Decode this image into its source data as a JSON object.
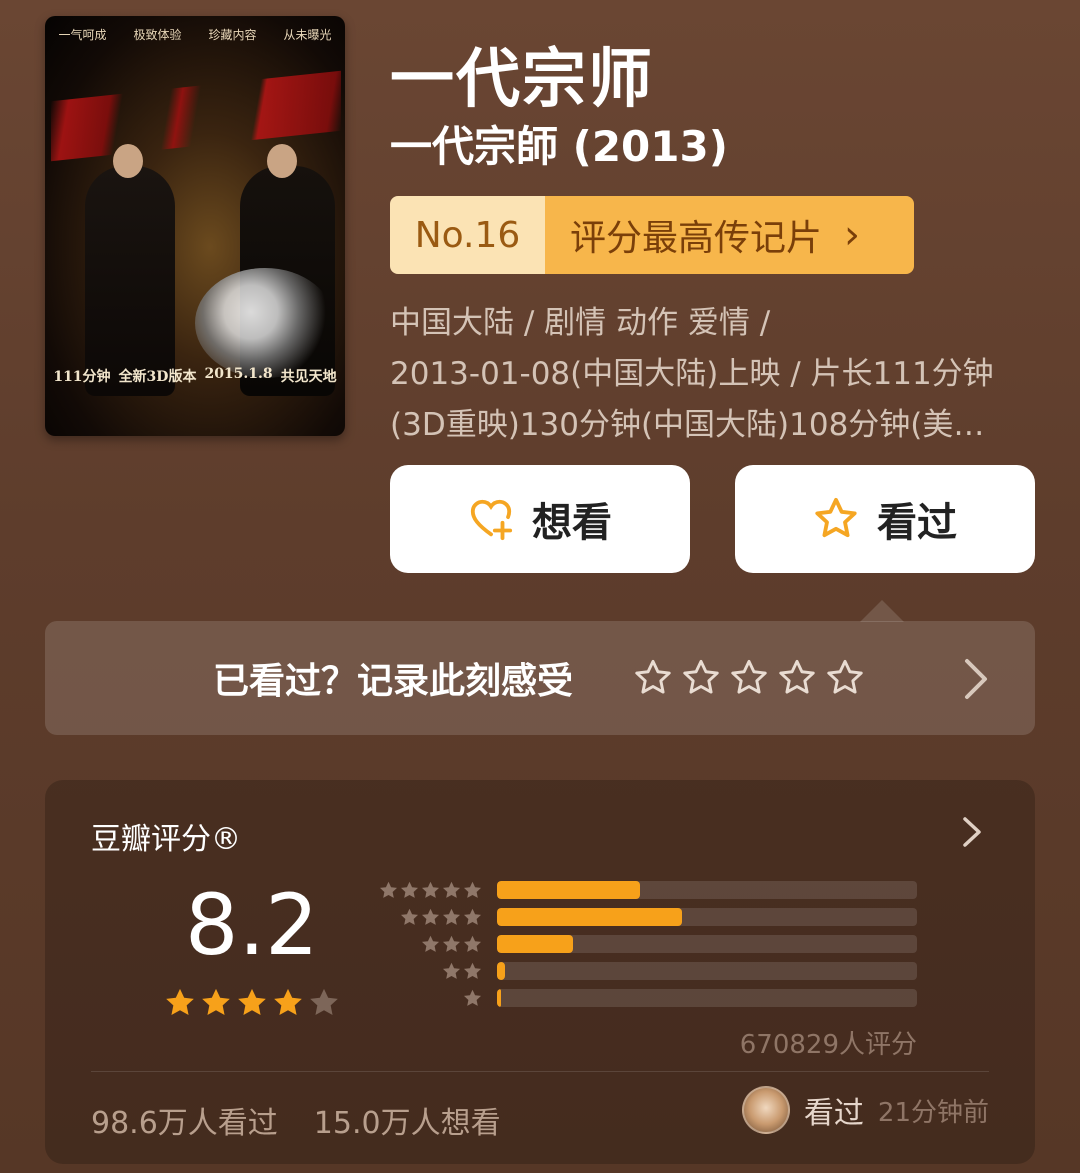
{
  "poster": {
    "top_strip": [
      "一气呵成",
      "极致体验",
      "珍藏内容",
      "从未曝光"
    ],
    "bottom_strip": [
      "111分钟",
      "全新3D版本",
      "2015.1.8",
      "共见天地"
    ]
  },
  "movie": {
    "title": "一代宗师",
    "original_title": "一代宗師 (2013)"
  },
  "rank": {
    "number": "No.16",
    "label": "评分最高传记片",
    "chevron": "›"
  },
  "info_lines": [
    "中国大陆 / 剧情 动作 爱情 /",
    "2013-01-08(中国大陆)上映 / 片长111分钟",
    "(3D重映)130分钟(中国大陆)108分钟(美…"
  ],
  "buttons": {
    "want": {
      "label": "想看",
      "icon": "heart-plus-icon"
    },
    "seen": {
      "label": "看过",
      "icon": "star-outline-icon"
    }
  },
  "record": {
    "prompt": "已看过？记录此刻感受",
    "stars": 5
  },
  "rating": {
    "header": "豆瓣评分®",
    "score": "8.2",
    "stars_filled": 4,
    "distribution": [
      {
        "stars": 5,
        "fraction": 0.34
      },
      {
        "stars": 4,
        "fraction": 0.44
      },
      {
        "stars": 3,
        "fraction": 0.18
      },
      {
        "stars": 2,
        "fraction": 0.02
      },
      {
        "stars": 1,
        "fraction": 0.01
      }
    ],
    "count_label": "670829人评分",
    "watched": "98.6万人看过",
    "wanted": "15.0万人想看",
    "recent_action": "看过",
    "recent_time": "21分钟前"
  },
  "colors": {
    "accent": "#f7a11a",
    "badge_left": "#fbe3b4",
    "badge_right": "#f7b64b",
    "background": "#5e3d2c"
  }
}
